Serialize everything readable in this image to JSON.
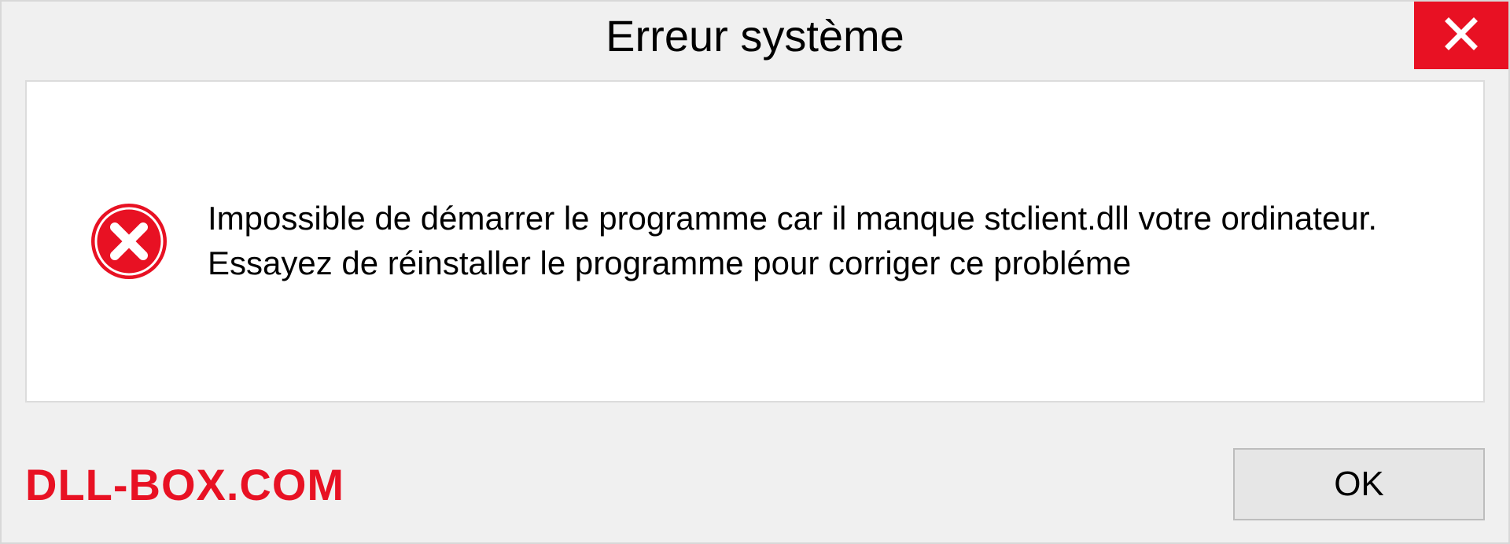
{
  "dialog": {
    "title": "Erreur système",
    "message": "Impossible de démarrer le programme car il manque stclient.dll votre ordinateur. Essayez de réinstaller le programme pour corriger ce probléme",
    "ok_label": "OK",
    "watermark": "DLL-BOX.COM"
  }
}
